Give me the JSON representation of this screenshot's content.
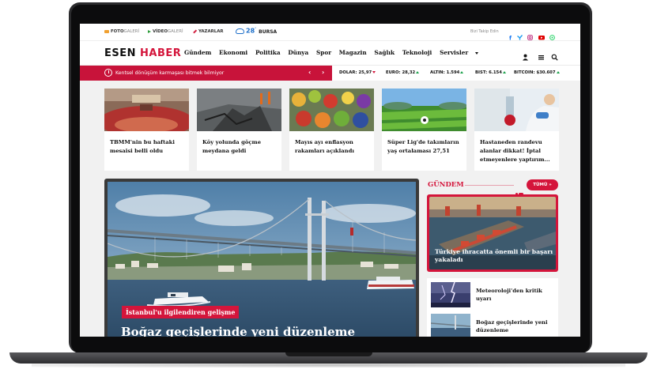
{
  "topbar": {
    "items": [
      {
        "main": "FOTO",
        "sub": "GALERİ"
      },
      {
        "main": "VİDEO",
        "sub": "GALERİ"
      },
      {
        "main": "YAZARLAR",
        "sub": ""
      }
    ],
    "weather": {
      "temp": "28",
      "unit": "°",
      "city": "BURSA"
    },
    "follow_text": "Bizi Takip Edin",
    "social_icons": [
      "facebook-icon",
      "twitter-icon",
      "instagram-icon",
      "youtube-icon",
      "whatsapp-icon"
    ],
    "social_colors": [
      "#1877f2",
      "#1d9bf0",
      "#c13584",
      "#e00000",
      "#25d366"
    ]
  },
  "header": {
    "logo_part1": "ESEN",
    "logo_part2": "HABER",
    "nav": [
      "Gündem",
      "Ekonomi",
      "Politika",
      "Dünya",
      "Spor",
      "Magazin",
      "Sağlık",
      "Teknoloji",
      "Servisler"
    ],
    "icons": [
      "user-icon",
      "menu-icon",
      "search-icon"
    ]
  },
  "breaking": {
    "text": "Kentsel dönüşüm karmaşası bitmek bilmiyor",
    "prev": "‹",
    "next": "›"
  },
  "tickers": [
    {
      "label": "DOLAR:",
      "value": "25,97",
      "trend": "down"
    },
    {
      "label": "EURO:",
      "value": "28,32",
      "trend": "up"
    },
    {
      "label": "ALTIN:",
      "value": "1.594",
      "trend": "up"
    },
    {
      "label": "BIST:",
      "value": "6.154",
      "trend": "up"
    },
    {
      "label": "BITCOIN:",
      "value": "$30.607",
      "trend": "up"
    }
  ],
  "cards": [
    {
      "title": "TBMM'nin bu haftaki mesaisi belli oldu"
    },
    {
      "title": "Köy yolunda göçme meydana geldi"
    },
    {
      "title": "Mayıs ayı enflasyon rakamları açıklandı"
    },
    {
      "title": "Süper Lig'de takımların yaş ortalaması 27,51"
    },
    {
      "title": "Hastaneden randevu alanlar dikkat! İptal etmeyenlere yaptırım..."
    }
  ],
  "feature": {
    "badge": "İstanbul'u ilgilendiren gelişme",
    "title": "Boğaz geçişlerinde yeni düzenleme"
  },
  "gundem": {
    "title": "GÜNDEM",
    "all_button": "TÜMÜ »",
    "featured_title": "Türkiye ihracatta önemli bir başarı yakaladı",
    "list": [
      {
        "title": "Meteoroloji'den kritik uyarı"
      },
      {
        "title": "Boğaz geçişlerinde yeni düzenleme"
      }
    ]
  },
  "colors": {
    "accent": "#d4153b",
    "breaking_bg": "#c8133a",
    "up": "#1aa14a",
    "down": "#d4153b"
  }
}
